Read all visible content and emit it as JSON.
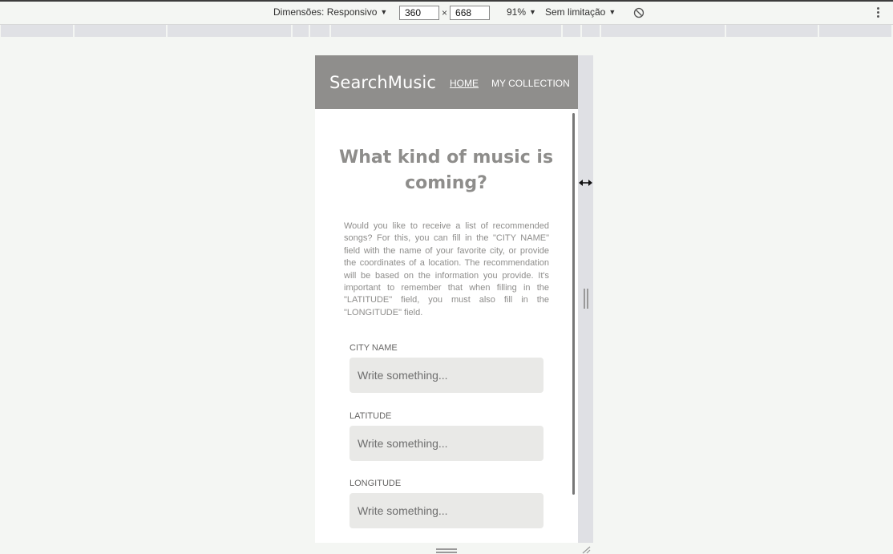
{
  "devtools": {
    "dimensions_label": "Dimensões: Responsivo",
    "width_value": "360",
    "times_sign": "×",
    "height_value": "668",
    "zoom": "91%",
    "throttle": "Sem limitação",
    "rotate_icon": "rotate-icon",
    "more_icon": "kebab-menu-icon"
  },
  "app": {
    "brand": "SearchMusic",
    "nav": {
      "home": "HOME",
      "collection": "MY COLLECTION"
    },
    "headline": "What kind of music is coming?",
    "intro": "Would you like to receive a list of recommended songs? For this, you can fill in the \"CITY NAME\" field with the name of your favorite city, or provide the coordinates of a location. The recommendation will be based on the information you provide. It's important to remember that when filling in the \"LATITUDE\" field, you must also fill in the \"LONGITUDE\" field.",
    "fields": [
      {
        "label": "CITY NAME",
        "placeholder": "Write something..."
      },
      {
        "label": "LATITUDE",
        "placeholder": "Write something..."
      },
      {
        "label": "LONGITUDE",
        "placeholder": "Write something..."
      }
    ]
  },
  "colors": {
    "header_bg": "#8f8e8c",
    "text_muted": "#8e8d8b",
    "input_bg": "#e9e9e7",
    "page_bg": "#f4f6f3"
  }
}
